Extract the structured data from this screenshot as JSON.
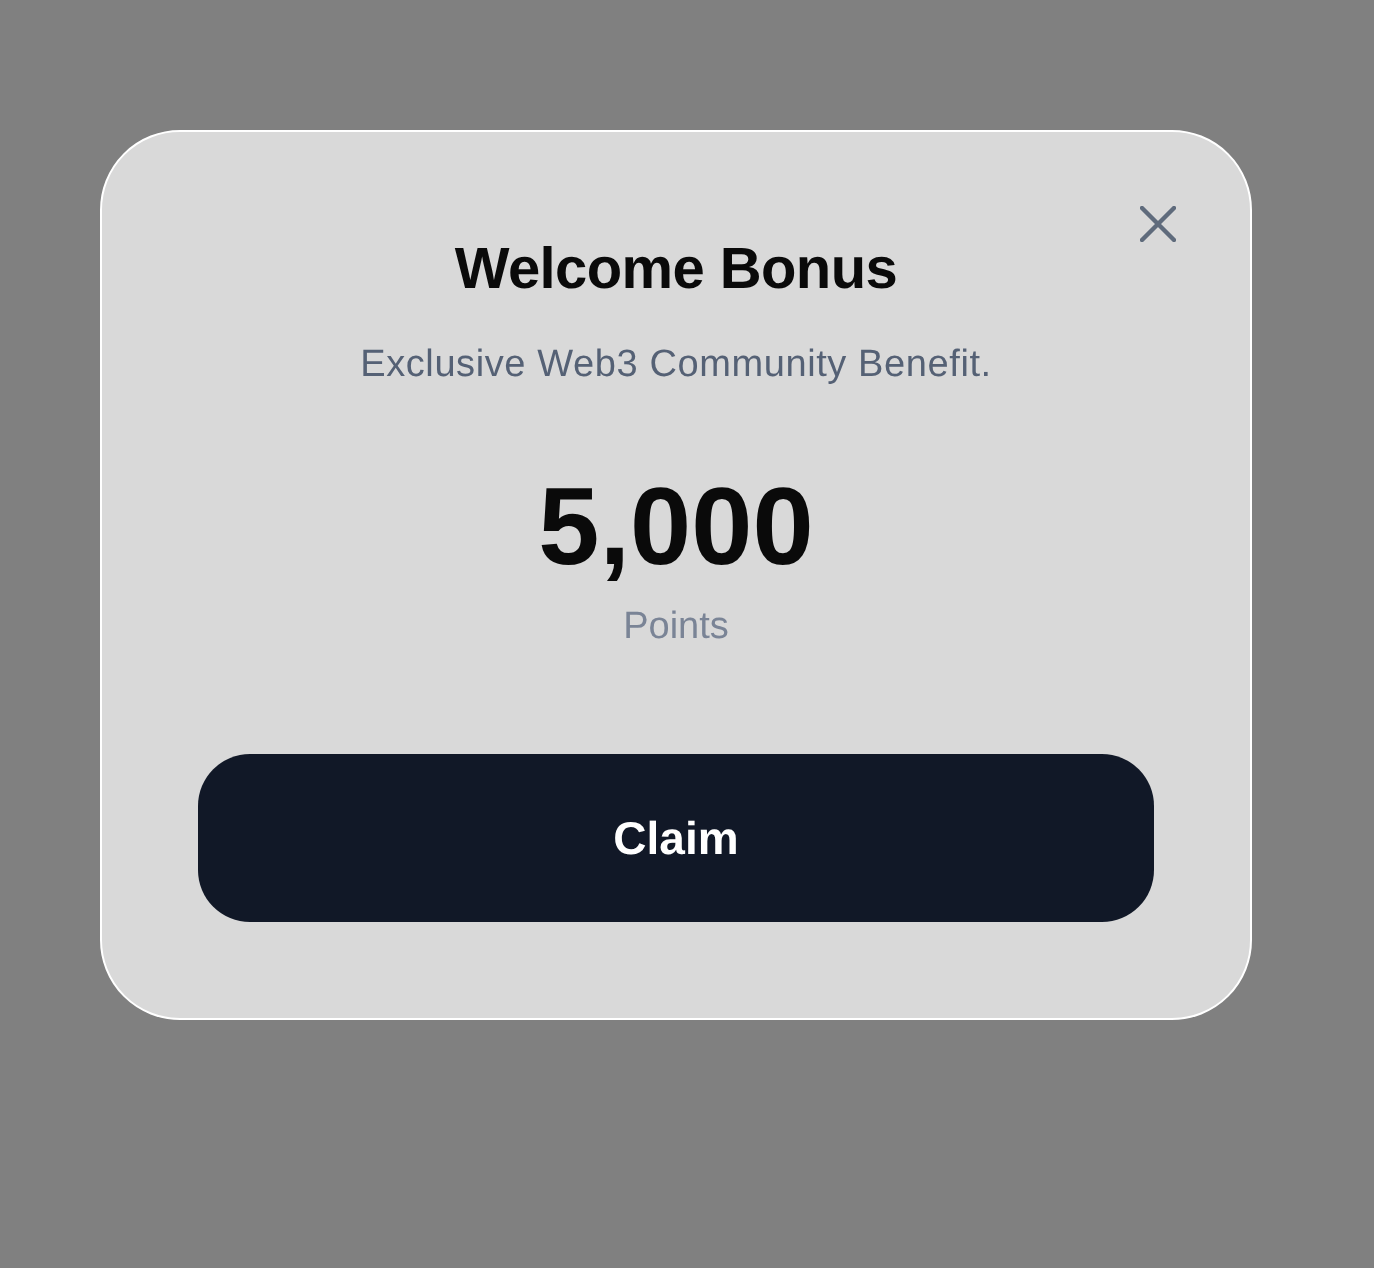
{
  "dialog": {
    "title": "Welcome Bonus",
    "subtitle": "Exclusive Web3 Community Benefit.",
    "amount": "5,000",
    "unit": "Points",
    "button": {
      "label": "Claim"
    }
  }
}
